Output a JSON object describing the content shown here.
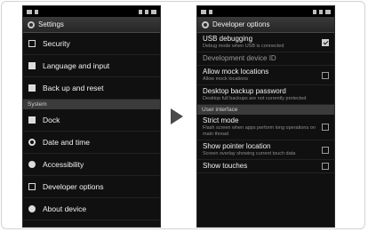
{
  "left": {
    "title": "Settings",
    "items_top": [
      {
        "label": "Security"
      },
      {
        "label": "Language and input"
      },
      {
        "label": "Back up and reset"
      }
    ],
    "section": "System",
    "items_bottom": [
      {
        "label": "Dock"
      },
      {
        "label": "Date and time"
      },
      {
        "label": "Accessibility"
      },
      {
        "label": "Developer options"
      },
      {
        "label": "About device"
      }
    ]
  },
  "right": {
    "title": "Developer options",
    "items_top": [
      {
        "title": "USB debugging",
        "subtitle": "Debug mode when USB is connected",
        "checked": true
      },
      {
        "title": "Development device ID",
        "subtitle": "",
        "checked": null
      },
      {
        "title": "Allow mock locations",
        "subtitle": "Allow mock locations",
        "checked": false
      },
      {
        "title": "Desktop backup password",
        "subtitle": "Desktop full backups are not currently protected",
        "checked": null
      }
    ],
    "section": "User interface",
    "items_bottom": [
      {
        "title": "Strict mode",
        "subtitle": "Flash screen when apps perform long operations on main thread",
        "checked": false
      },
      {
        "title": "Show pointer location",
        "subtitle": "Screen overlay showing current touch data",
        "checked": false
      },
      {
        "title": "Show touches",
        "subtitle": "",
        "checked": false
      }
    ]
  },
  "colors": {
    "background": "#101010",
    "section": "#3b3b3b",
    "arrow": "#4a4a4a"
  }
}
